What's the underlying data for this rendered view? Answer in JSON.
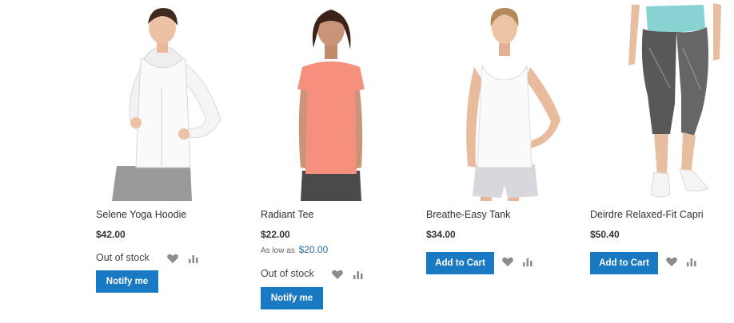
{
  "products": [
    {
      "name": "Selene Yoga Hoodie",
      "price": "$42.00",
      "stock": "Out of stock",
      "button": "Notify me"
    },
    {
      "name": "Radiant Tee",
      "price": "$22.00",
      "as_low_as_label": "As low as",
      "as_low_as_price": "$20.00",
      "stock": "Out of stock",
      "button": "Notify me"
    },
    {
      "name": "Breathe-Easy Tank",
      "price": "$34.00",
      "button": "Add to Cart"
    },
    {
      "name": "Deirdre Relaxed-Fit Capri",
      "price": "$50.40",
      "button": "Add to Cart"
    }
  ],
  "icons": {
    "wishlist": "heart-icon",
    "compare": "bar-chart-icon"
  },
  "colors": {
    "button": "#1979c3",
    "button_text": "#ffffff",
    "icon": "#8c8c8c",
    "low_price": "#2e6fa3"
  }
}
